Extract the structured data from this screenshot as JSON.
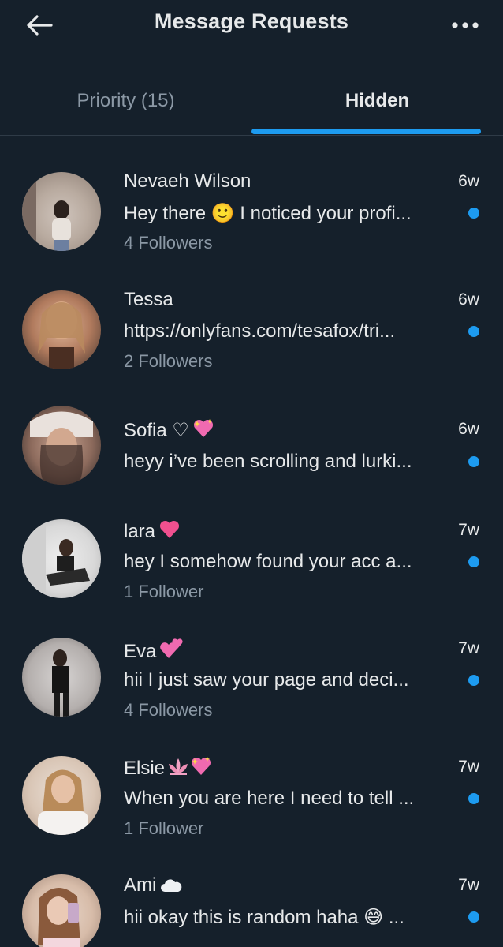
{
  "header": {
    "title": "Message Requests",
    "back_icon": "arrow-left-icon",
    "more_icon": "more-horizontal-icon"
  },
  "tabs": [
    {
      "label": "Priority (15)",
      "selected": false
    },
    {
      "label": "Hidden",
      "selected": true
    }
  ],
  "colors": {
    "background": "#15202b",
    "accent": "#1d9bf0",
    "secondary_text": "#8b98a5"
  },
  "requests": [
    {
      "name": "Nevaeh Wilson",
      "time": "6w",
      "message": "Hey there 🙂 I noticed your profi...",
      "followers": "4 Followers",
      "unread": true
    },
    {
      "name": "Tessa",
      "time": "6w",
      "message": "https://onlyfans.com/tesafox/tri...",
      "followers": "2 Followers",
      "unread": true
    },
    {
      "name": "Sofia ♡",
      "time": "6w",
      "message": "heyy i’ve been scrolling and lurki...",
      "followers": "",
      "unread": true
    },
    {
      "name": "lara",
      "time": "7w",
      "message": "hey I somehow found your acc a...",
      "followers": "1 Follower",
      "unread": true
    },
    {
      "name": "Eva",
      "time": "7w",
      "message": "hii I just saw your page and deci...",
      "followers": "4 Followers",
      "unread": true
    },
    {
      "name": "Elsie",
      "time": "7w",
      "message": "When you are here I need to tell ...",
      "followers": "1 Follower",
      "unread": true
    },
    {
      "name": "Ami",
      "time": "7w",
      "message": "hii okay this is random haha 😅 ...",
      "followers": "",
      "unread": true
    }
  ]
}
